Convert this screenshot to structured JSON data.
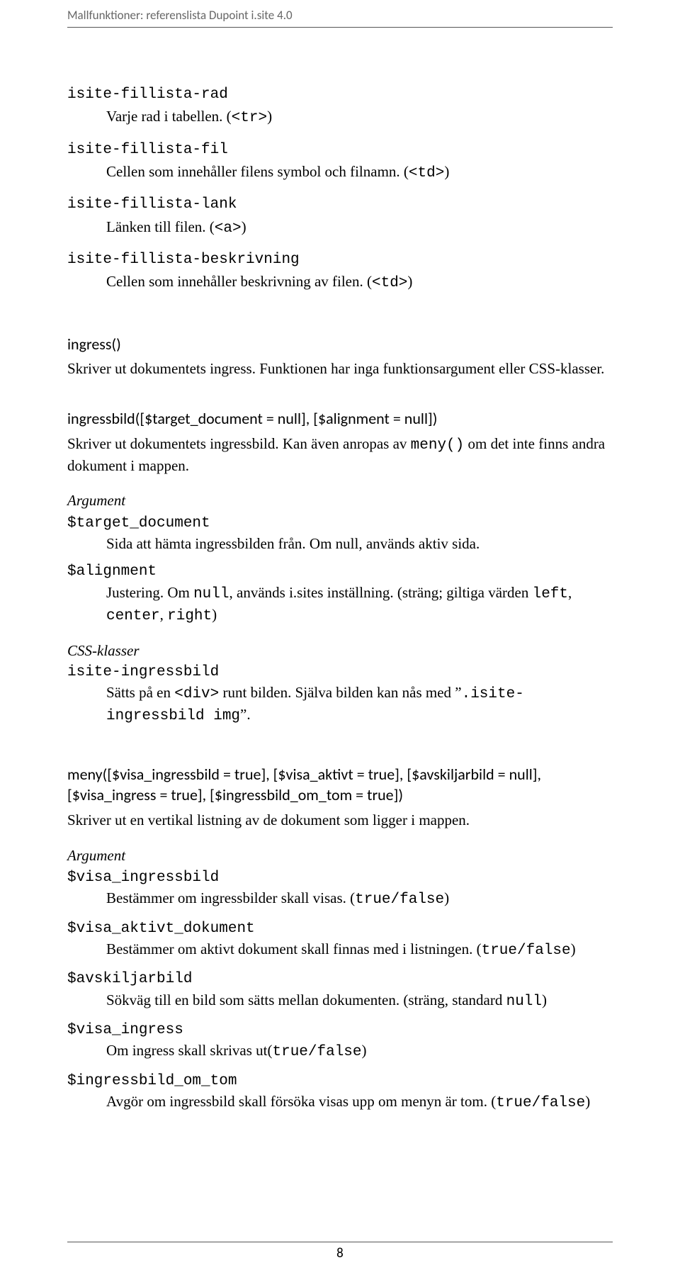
{
  "header": "Mallfunktioner: referenslista Dupoint i.site 4.0",
  "page_number": "8",
  "classlist": [
    {
      "name": "isite-fillista-rad",
      "desc_pre": "Varje rad i tabellen. (",
      "desc_code": "<tr>",
      "desc_post": ")"
    },
    {
      "name": "isite-fillista-fil",
      "desc_pre": "Cellen som innehåller filens symbol och filnamn. (",
      "desc_code": "<td>",
      "desc_post": ")"
    },
    {
      "name": "isite-fillista-lank",
      "desc_pre": "Länken till filen. (",
      "desc_code": "<a>",
      "desc_post": ")"
    },
    {
      "name": "isite-fillista-beskrivning",
      "desc_pre": "Cellen som innehåller beskrivning av filen. (",
      "desc_code": "<td>",
      "desc_post": ")"
    }
  ],
  "ingress": {
    "sig": "ingress()",
    "desc": "Skriver ut dokumentets ingress. Funktionen har inga funktionsargument eller CSS-klasser."
  },
  "ingressbild": {
    "sig": "ingressbild([$target_document = null], [$alignment = null])",
    "desc_pre": "Skriver ut dokumentets ingressbild. Kan även anropas av ",
    "desc_code": "meny()",
    "desc_post": " om det inte finns andra dokument i mappen.",
    "arg_heading": "Argument",
    "args": [
      {
        "name": "$target_document",
        "segments": [
          {
            "t": "Sida att hämta ingressbilden från. Om null, används aktiv sida.",
            "c": false
          }
        ]
      },
      {
        "name": "$alignment",
        "segments": [
          {
            "t": "Justering. Om ",
            "c": false
          },
          {
            "t": "null",
            "c": true
          },
          {
            "t": ", används i.sites inställning. (sträng; giltiga värden ",
            "c": false
          },
          {
            "t": "left",
            "c": true
          },
          {
            "t": ", ",
            "c": false
          },
          {
            "t": "center",
            "c": true
          },
          {
            "t": ", ",
            "c": false
          },
          {
            "t": "right",
            "c": true
          },
          {
            "t": ")",
            "c": false
          }
        ]
      }
    ],
    "css_heading": "CSS-klasser",
    "css": [
      {
        "name": "isite-ingressbild",
        "segments": [
          {
            "t": "Sätts på en ",
            "c": false
          },
          {
            "t": "<div>",
            "c": true
          },
          {
            "t": " runt bilden. Själva bilden kan nås med ”",
            "c": false
          },
          {
            "t": ".isite-ingressbild img",
            "c": true
          },
          {
            "t": "”.",
            "c": false
          }
        ]
      }
    ]
  },
  "meny": {
    "sig": "meny([$visa_ingressbild = true], [$visa_aktivt = true], [$avskiljarbild = null], [$visa_ingress = true], [$ingressbild_om_tom = true])",
    "desc": "Skriver ut en vertikal listning av de dokument som ligger i mappen.",
    "arg_heading": "Argument",
    "args": [
      {
        "name": "$visa_ingressbild",
        "segments": [
          {
            "t": "Bestämmer om ingressbilder skall visas. (",
            "c": false
          },
          {
            "t": "true/false",
            "c": true
          },
          {
            "t": ")",
            "c": false
          }
        ]
      },
      {
        "name": "$visa_aktivt_dokument",
        "segments": [
          {
            "t": "Bestämmer om aktivt dokument skall finnas med i listningen. (",
            "c": false
          },
          {
            "t": "true/false",
            "c": true
          },
          {
            "t": ")",
            "c": false
          }
        ]
      },
      {
        "name": "$avskiljarbild",
        "segments": [
          {
            "t": "Sökväg till en bild som sätts mellan dokumenten. (sträng, standard ",
            "c": false
          },
          {
            "t": "null",
            "c": true
          },
          {
            "t": ")",
            "c": false
          }
        ]
      },
      {
        "name": "$visa_ingress",
        "segments": [
          {
            "t": "Om ingress skall skrivas ut(",
            "c": false
          },
          {
            "t": "true/false",
            "c": true
          },
          {
            "t": ")",
            "c": false
          }
        ]
      },
      {
        "name": "$ingressbild_om_tom",
        "segments": [
          {
            "t": "Avgör om ingressbild skall försöka visas upp om menyn är tom. (",
            "c": false
          },
          {
            "t": "true/false",
            "c": true
          },
          {
            "t": ")",
            "c": false
          }
        ]
      }
    ]
  }
}
